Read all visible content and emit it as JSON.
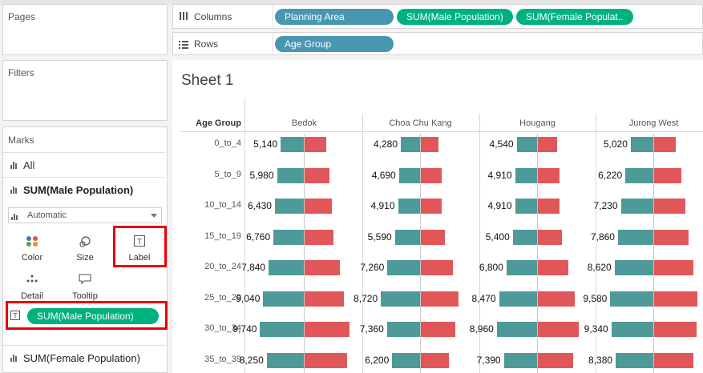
{
  "shelves": {
    "pages_label": "Pages",
    "filters_label": "Filters",
    "columns_label": "Columns",
    "rows_label": "Rows",
    "columns_pills": [
      "Planning Area",
      "SUM(Male Population)",
      "SUM(Female Populat.."
    ],
    "rows_pills": [
      "Age Group"
    ]
  },
  "marks": {
    "title": "Marks",
    "all_label": "All",
    "male_label": "SUM(Male Population)",
    "mark_type": "Automatic",
    "buttons": [
      "Color",
      "Size",
      "Label",
      "Detail",
      "Tooltip"
    ],
    "label_pill": "SUM(Male Population)",
    "female_label": "SUM(Female Population)"
  },
  "sheet": {
    "title": "Sheet 1",
    "row_header": "Age Group"
  },
  "colors": {
    "male": "#4e9a98",
    "female": "#e15759",
    "pill_blue": "#4996b2",
    "pill_green": "#00b180",
    "highlight": "#e8000b"
  },
  "chart_data": {
    "type": "bar",
    "categories": [
      "0_to_4",
      "5_to_9",
      "10_to_14",
      "15_to_19",
      "20_to_24",
      "25_to_29",
      "30_to_34",
      "35_to_39"
    ],
    "panels": [
      "Bedok",
      "Choa Chu Kang",
      "Hougang",
      "Jurong West"
    ],
    "series": [
      {
        "name": "SUM(Male Population)",
        "values": {
          "Bedok": [
            5140,
            5980,
            6430,
            6760,
            7840,
            9040,
            9740,
            8250
          ],
          "Choa Chu Kang": [
            4280,
            4690,
            4910,
            5590,
            7260,
            8720,
            7360,
            6200
          ],
          "Hougang": [
            4540,
            4910,
            4910,
            5400,
            6800,
            8470,
            8960,
            7390
          ],
          "Jurong West": [
            5020,
            6220,
            7230,
            7860,
            8620,
            9580,
            9340,
            8380
          ]
        },
        "labels": {
          "Bedok": [
            "5,140",
            "5,980",
            "6,430",
            "6,760",
            "7,840",
            "9,040",
            "9,740",
            "8,250"
          ],
          "Choa Chu Kang": [
            "4,280",
            "4,690",
            "4,910",
            "5,590",
            "7,260",
            "8,720",
            "7,360",
            "6,200"
          ],
          "Hougang": [
            "4,540",
            "4,910",
            "4,910",
            "5,400",
            "6,800",
            "8,470",
            "8,960",
            "7,390"
          ],
          "Jurong West": [
            "5,020",
            "6,220",
            "7,230",
            "7,860",
            "8,620",
            "9,580",
            "9,340",
            "8,380"
          ]
        }
      },
      {
        "name": "SUM(Female Population)",
        "values": {
          "Bedok": [
            4900,
            5600,
            6000,
            6400,
            7800,
            8800,
            10000,
            9400
          ],
          "Choa Chu Kang": [
            4000,
            4600,
            4700,
            5300,
            7100,
            8400,
            7600,
            6300
          ],
          "Hougang": [
            4300,
            4800,
            4800,
            5300,
            6800,
            8300,
            9100,
            7800
          ],
          "Jurong West": [
            4800,
            6000,
            7000,
            7600,
            8800,
            9700,
            9500,
            8800
          ]
        }
      }
    ]
  }
}
